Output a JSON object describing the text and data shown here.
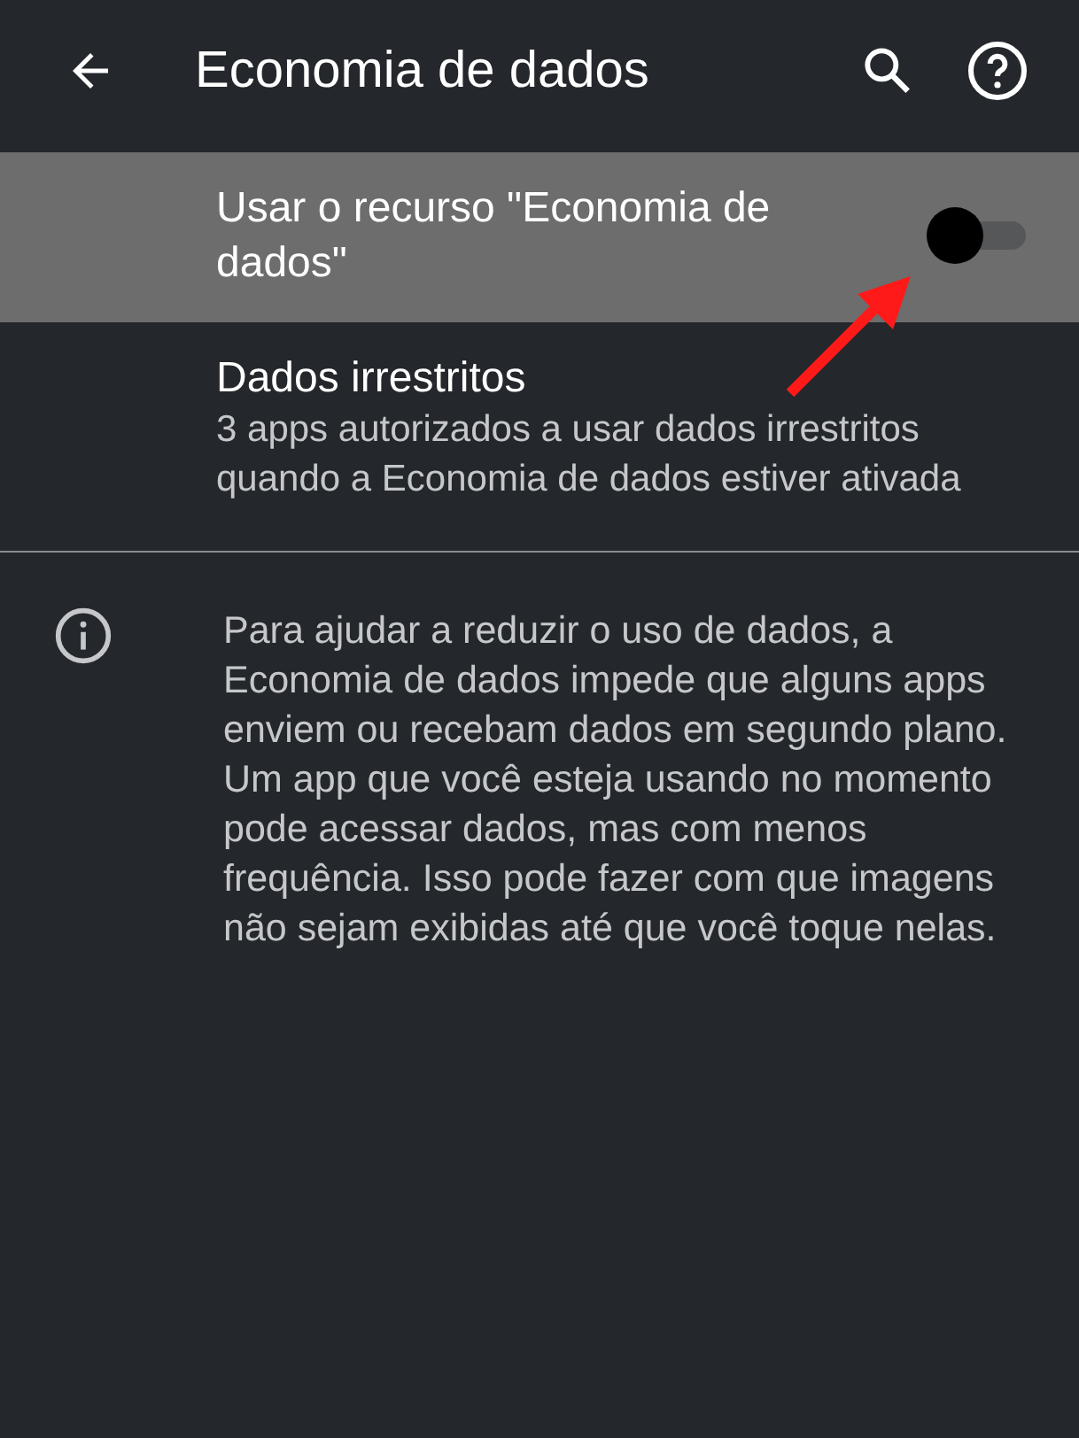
{
  "toolbar": {
    "title": "Economia de dados"
  },
  "settings": [
    {
      "kind": "switch",
      "title": "Usar o recurso \"Economia de dados\"",
      "on": false,
      "highlighted": true
    },
    {
      "kind": "link",
      "title": "Dados irrestritos",
      "summary": "3 apps autorizados a usar dados irrestritos quando a Economia de dados estiver ativada",
      "highlighted": false
    }
  ],
  "footer": {
    "text": "Para ajudar a reduzir o uso de dados, a Economia de dados impede que alguns apps enviem ou recebam dados em segundo plano. Um app que você esteja usando no momento pode acessar dados, mas com menos frequência. Isso pode fazer com que imagens não sejam exibidas até que você toque nelas."
  }
}
